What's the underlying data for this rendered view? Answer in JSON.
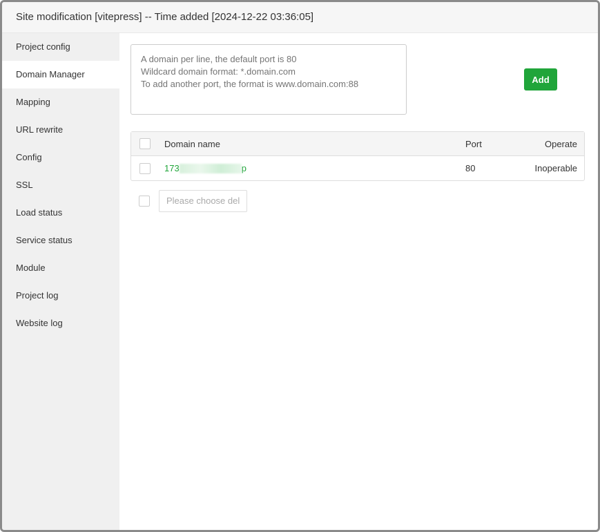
{
  "window": {
    "title": "Site modification [vitepress] -- Time added [2024-12-22 03:36:05]"
  },
  "sidebar": {
    "items": [
      {
        "label": "Project config"
      },
      {
        "label": "Domain Manager"
      },
      {
        "label": "Mapping"
      },
      {
        "label": "URL rewrite"
      },
      {
        "label": "Config"
      },
      {
        "label": "SSL"
      },
      {
        "label": "Load status"
      },
      {
        "label": "Service status"
      },
      {
        "label": "Module"
      },
      {
        "label": "Project log"
      },
      {
        "label": "Website log"
      }
    ]
  },
  "domain": {
    "placeholder": "A domain per line, the default port is 80\nWildcard domain format: *.domain.com\nTo add another port, the format is www.domain.com:88",
    "add_label": "Add",
    "table": {
      "headers": {
        "name": "Domain name",
        "port": "Port",
        "operate": "Operate"
      },
      "rows": [
        {
          "name_prefix": "173",
          "name_suffix": "p",
          "port": "80",
          "operate": "Inoperable"
        }
      ]
    },
    "batch_placeholder": "Please choose del"
  },
  "colors": {
    "accent": "#20a53a"
  }
}
